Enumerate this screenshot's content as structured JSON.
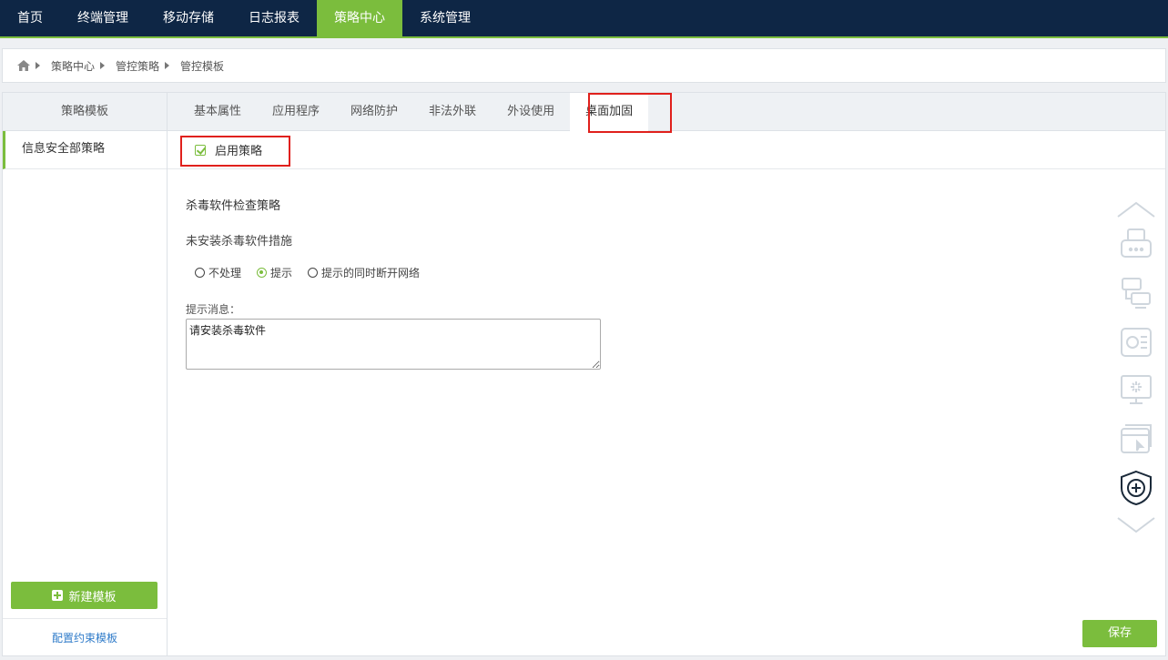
{
  "nav": {
    "items": [
      {
        "label": "首页",
        "active": false
      },
      {
        "label": "终端管理",
        "active": false
      },
      {
        "label": "移动存储",
        "active": false
      },
      {
        "label": "日志报表",
        "active": false
      },
      {
        "label": "策略中心",
        "active": true
      },
      {
        "label": "系统管理",
        "active": false
      }
    ]
  },
  "breadcrumb": [
    "策略中心",
    "管控策略",
    "管控模板"
  ],
  "sidebar": {
    "title": "策略模板",
    "items": [
      "信息安全部策略"
    ],
    "new_button": "新建模板",
    "config_link": "配置约束模板"
  },
  "tabs": [
    "基本属性",
    "应用程序",
    "网络防护",
    "非法外联",
    "外设使用",
    "桌面加固"
  ],
  "active_tab": "桌面加固",
  "enable_label": "启用策略",
  "form": {
    "section_title": "杀毒软件检查策略",
    "measure_label": "未安装杀毒软件措施",
    "options": [
      "不处理",
      "提示",
      "提示的同时断开网络"
    ],
    "selected_option": "提示",
    "message_label": "提示消息：",
    "message_value": "请安装杀毒软件"
  },
  "rail_icons": [
    "chevron-up-icon",
    "printer-icon",
    "device-connect-icon",
    "settings-list-icon",
    "desktop-loading-icon",
    "browser-window-icon",
    "shield-plus-icon",
    "chevron-down-icon"
  ],
  "save_button": "保存",
  "colors": {
    "nav_bg": "#0e2645",
    "accent": "#7bbd3d",
    "highlight": "#e0201c",
    "link": "#2f7bc9"
  }
}
